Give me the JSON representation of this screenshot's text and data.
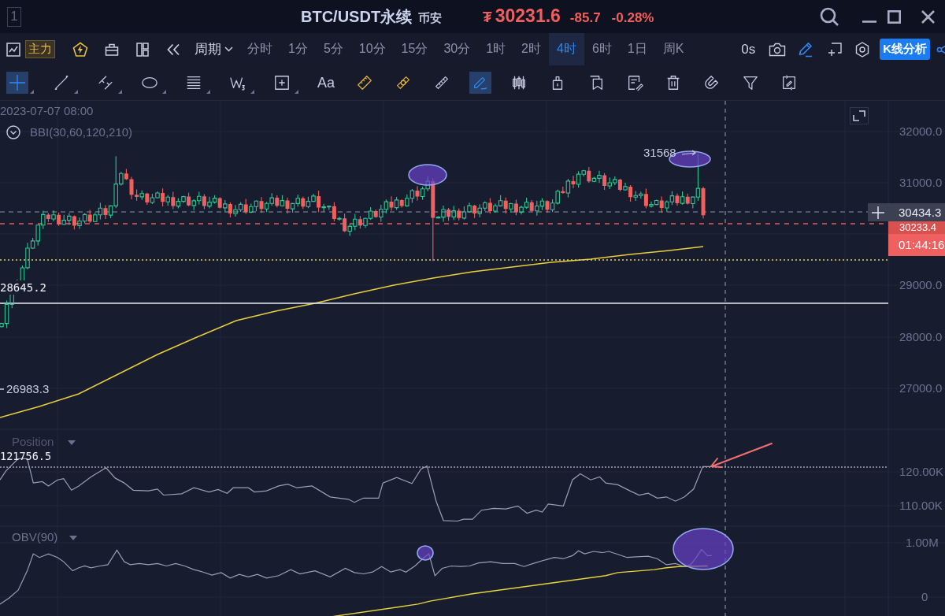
{
  "window": {
    "number": "1",
    "symbol": "BTC/USDT永续",
    "exchange": "币安",
    "currency": "₮",
    "price": "30231.6",
    "change": "-85.7",
    "change_percent": "-0.28%"
  },
  "toolbar": {
    "indicator_badge": "主力",
    "period_menu": "周期",
    "intervals": [
      {
        "label": "分时",
        "selected": false
      },
      {
        "label": "1分",
        "selected": false
      },
      {
        "label": "5分",
        "selected": false
      },
      {
        "label": "10分",
        "selected": false
      },
      {
        "label": "15分",
        "selected": false
      },
      {
        "label": "30分",
        "selected": false
      },
      {
        "label": "1时",
        "selected": false
      },
      {
        "label": "2时",
        "selected": false
      },
      {
        "label": "4时",
        "selected": true
      },
      {
        "label": "6时",
        "selected": false
      },
      {
        "label": "1日",
        "selected": false
      },
      {
        "label": "周K",
        "selected": false
      }
    ],
    "timer": "0s",
    "draw_toggle": {
      "on": true
    },
    "analysis_button": "K线分析"
  },
  "drawing_tools": [
    {
      "kind": "icon",
      "selected": true,
      "submenu": true,
      "on": false
    },
    {
      "kind": "icon",
      "selected": false,
      "submenu": true,
      "on": false
    },
    {
      "kind": "icon",
      "selected": false,
      "submenu": true,
      "on": false
    },
    {
      "kind": "icon",
      "selected": false,
      "submenu": true,
      "on": false
    },
    {
      "kind": "icon",
      "selected": false,
      "submenu": true,
      "on": false
    },
    {
      "kind": "icon",
      "selected": false,
      "submenu": true,
      "on": false
    },
    {
      "kind": "icon",
      "selected": false,
      "submenu": true,
      "on": false
    },
    {
      "kind": "text",
      "label": "Aa",
      "selected": false,
      "submenu": false,
      "on": false
    },
    {
      "kind": "icon",
      "selected": false,
      "submenu": false,
      "on": true
    },
    {
      "kind": "icon",
      "selected": false,
      "submenu": false,
      "on": true
    },
    {
      "kind": "icon",
      "selected": false,
      "submenu": false,
      "on": false
    },
    {
      "kind": "icon",
      "selected": true,
      "submenu": false,
      "on": false
    },
    {
      "kind": "icon",
      "selected": false,
      "submenu": false,
      "on": false
    },
    {
      "kind": "icon",
      "selected": false,
      "submenu": false,
      "on": false
    },
    {
      "kind": "icon",
      "selected": false,
      "submenu": false,
      "on": false
    },
    {
      "kind": "icon",
      "selected": false,
      "submenu": false,
      "on": false
    },
    {
      "kind": "icon",
      "selected": false,
      "submenu": false,
      "on": false
    },
    {
      "kind": "icon",
      "selected": false,
      "submenu": false,
      "on": false
    },
    {
      "kind": "icon",
      "selected": false,
      "submenu": false,
      "on": false
    },
    {
      "kind": "icon",
      "selected": false,
      "submenu": false,
      "on": false
    }
  ],
  "chart": {
    "timestamp": "2023-07-07 08:00",
    "indicator": "BBI(30,60,120,210)",
    "high_label": "31568",
    "level_label": "28645.2",
    "low_label": "26983.3",
    "price_axis": [
      "32000.0",
      "31000.0",
      "29000.0",
      "28000.0",
      "27000.0"
    ],
    "last_price": "30434.3",
    "mark_price": "30233.4",
    "countdown": "01:44:16"
  },
  "position_panel": {
    "title": "Position",
    "value": "121756.5",
    "axis": [
      "120.00K",
      "110.00K"
    ]
  },
  "obv_panel": {
    "title": "OBV(90)",
    "axis": [
      "1.00M",
      "0"
    ]
  }
}
